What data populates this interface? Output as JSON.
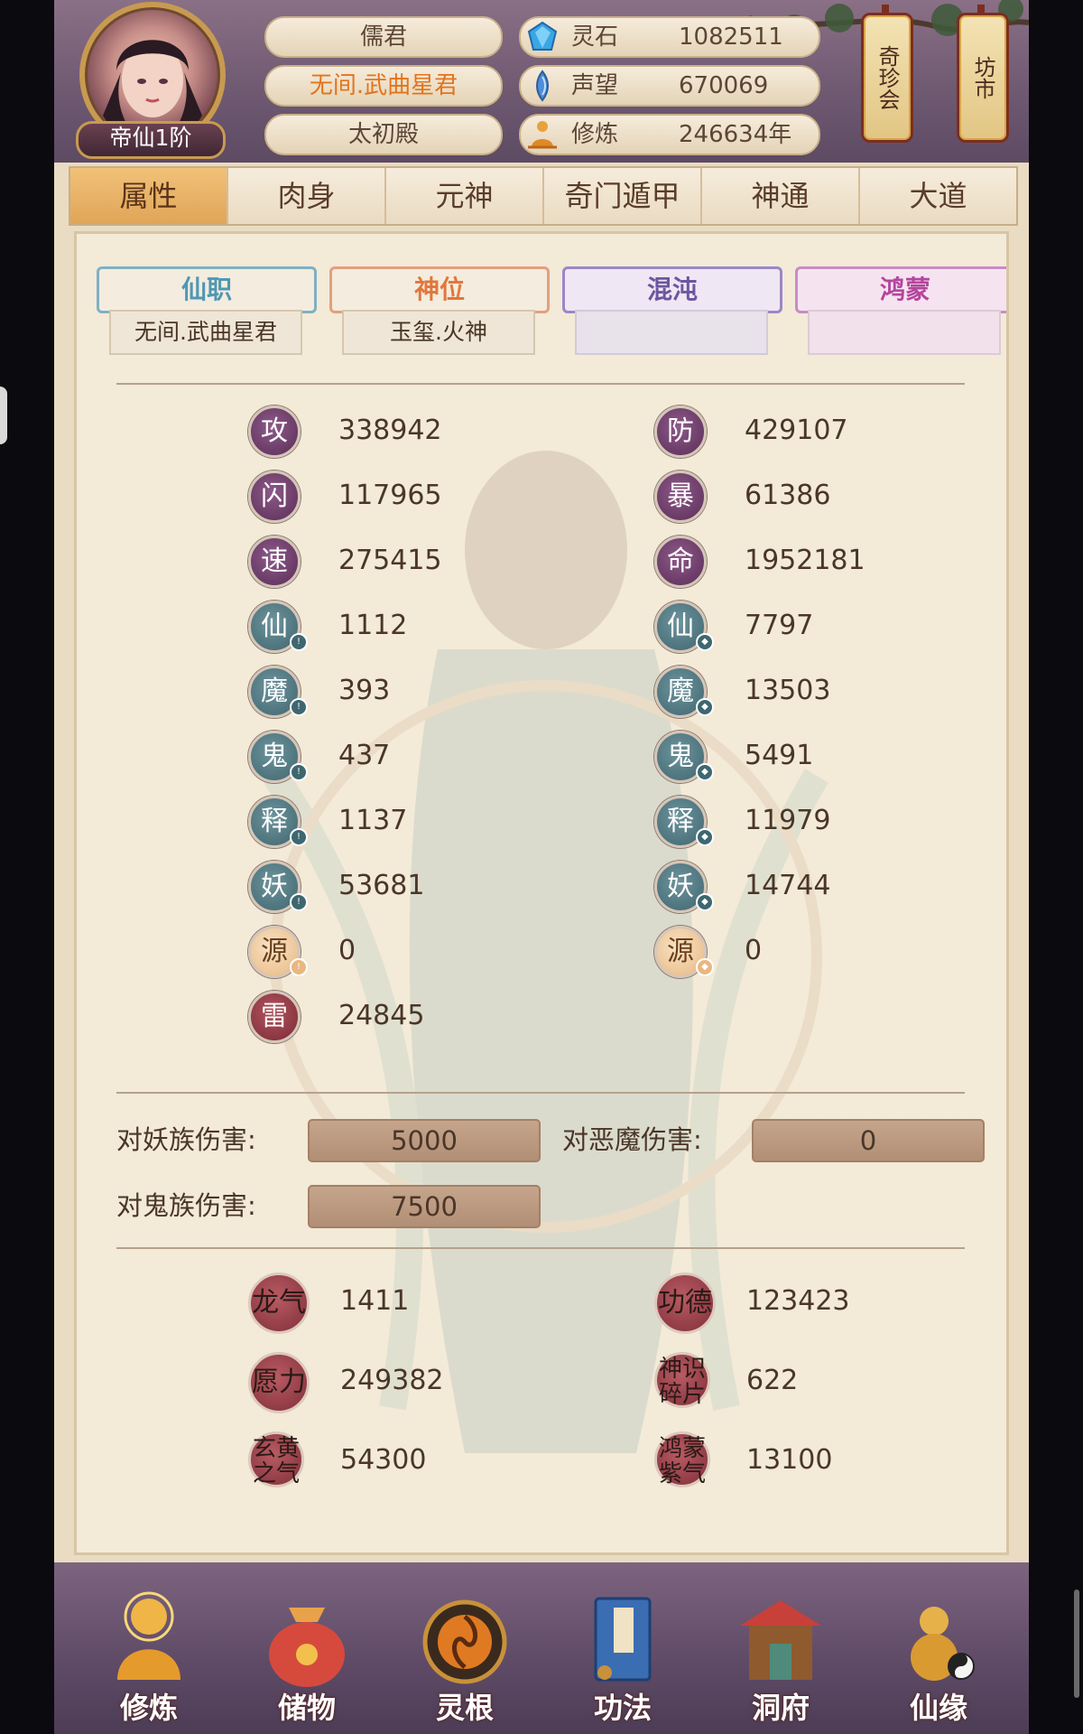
{
  "header": {
    "rank": "帝仙1阶",
    "info": [
      "儒君",
      "无间.武曲星君",
      "太初殿"
    ],
    "resources": [
      {
        "icon": "spirit-stone-icon",
        "label": "灵石",
        "value": "1082511"
      },
      {
        "icon": "prestige-icon",
        "label": "声望",
        "value": "670069"
      },
      {
        "icon": "cultivation-icon",
        "label": "修炼",
        "value": "246634年"
      }
    ],
    "lanterns": [
      "奇珍会",
      "坊市"
    ]
  },
  "tabs": [
    {
      "label": "属性",
      "active": true
    },
    {
      "label": "肉身"
    },
    {
      "label": "元神"
    },
    {
      "label": "奇门遁甲"
    },
    {
      "label": "神通"
    },
    {
      "label": "大道"
    }
  ],
  "subtabs": [
    {
      "label": "仙职",
      "value": "无间.武曲星君"
    },
    {
      "label": "神位",
      "value": "玉玺.火神"
    },
    {
      "label": "混沌",
      "value": ""
    },
    {
      "label": "鸿蒙",
      "value": ""
    }
  ],
  "stats_left": [
    {
      "glyph": "攻",
      "value": "338942"
    },
    {
      "glyph": "闪",
      "value": "117965"
    },
    {
      "glyph": "速",
      "value": "275415"
    },
    {
      "glyph": "仙",
      "value": "1112"
    },
    {
      "glyph": "魔",
      "value": "393"
    },
    {
      "glyph": "鬼",
      "value": "437"
    },
    {
      "glyph": "释",
      "value": "1137"
    },
    {
      "glyph": "妖",
      "value": "53681"
    },
    {
      "glyph": "源",
      "value": "0"
    },
    {
      "glyph": "雷",
      "value": "24845"
    }
  ],
  "stats_right": [
    {
      "glyph": "防",
      "value": "429107"
    },
    {
      "glyph": "暴",
      "value": "61386"
    },
    {
      "glyph": "命",
      "value": "1952181"
    },
    {
      "glyph": "仙",
      "value": "7797"
    },
    {
      "glyph": "魔",
      "value": "13503"
    },
    {
      "glyph": "鬼",
      "value": "5491"
    },
    {
      "glyph": "释",
      "value": "11979"
    },
    {
      "glyph": "妖",
      "value": "14744"
    },
    {
      "glyph": "源",
      "value": "0"
    }
  ],
  "damage": {
    "yao_label": "对妖族伤害:",
    "yao_value": "5000",
    "demon_label": "对恶魔伤害:",
    "demon_value": "0",
    "ghost_label": "对鬼族伤害:",
    "ghost_value": "7500"
  },
  "special": [
    {
      "label": "龙气",
      "value": "1411"
    },
    {
      "label": "功德",
      "value": "123423"
    },
    {
      "label": "愿力",
      "value": "249382"
    },
    {
      "label": "神识碎片",
      "value": "622"
    },
    {
      "label": "玄黄之气",
      "value": "54300"
    },
    {
      "label": "鸿蒙紫气",
      "value": "13100"
    }
  ],
  "bottom_nav": [
    "修炼",
    "储物",
    "灵根",
    "功法",
    "洞府",
    "仙缘"
  ],
  "colors": {
    "accent": "#e0a558",
    "panel": "#f3ead8",
    "header": "#6f5a72"
  }
}
